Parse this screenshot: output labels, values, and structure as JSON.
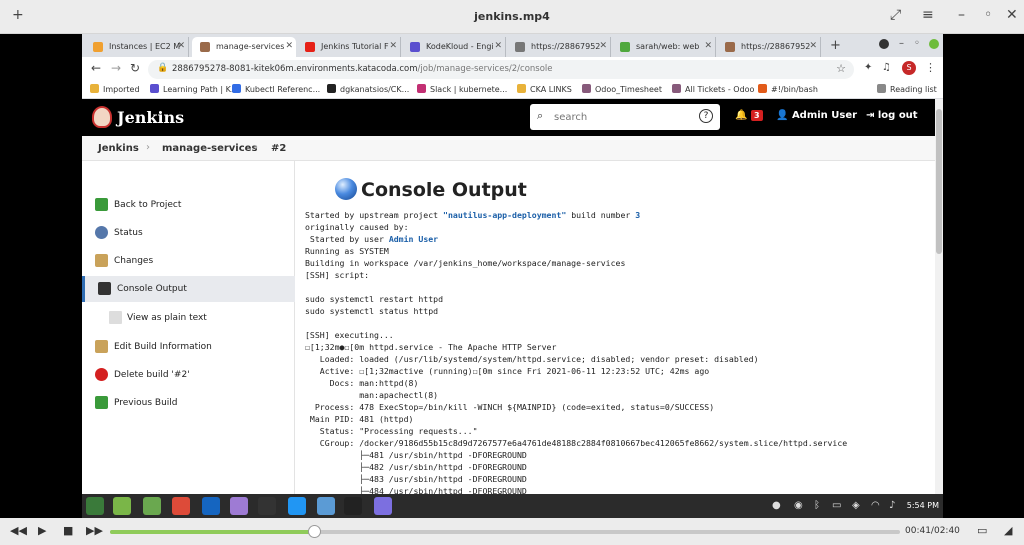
{
  "player": {
    "title": "jenkins.mp4",
    "add_label": "+",
    "timecode": "00:41/02:40",
    "progress": 0.258
  },
  "browser": {
    "tabs": [
      {
        "label": "Instances | EC2 M",
        "color": "#f0a030"
      },
      {
        "label": "manage-services",
        "color": "#9a6a4a",
        "active": true
      },
      {
        "label": "Jenkins Tutorial F",
        "color": "#e62117"
      },
      {
        "label": "KodeKloud - Engi",
        "color": "#5a4fcf"
      },
      {
        "label": "https://28867952",
        "color": "#777777"
      },
      {
        "label": "sarah/web: web",
        "color": "#4fa83d"
      },
      {
        "label": "https://28867952",
        "color": "#9a6a4a"
      }
    ],
    "new_tab": "+",
    "url_host": "2886795278-8081-kitek06m.environments.katacoda.com",
    "url_path": "/job/manage-services/2/console",
    "profile_initial": "S",
    "bookmarks": [
      {
        "label": "Imported",
        "color": "#e8b23a"
      },
      {
        "label": "Learning Path | K...",
        "color": "#5a4fcf"
      },
      {
        "label": "Kubectl Referenc...",
        "color": "#326ce5"
      },
      {
        "label": "dgkanatsios/CK...",
        "color": "#222222"
      },
      {
        "label": "Slack | kubernete...",
        "color": "#c22f73"
      },
      {
        "label": "CKA LINKS",
        "color": "#e8b23a"
      },
      {
        "label": "Odoo_Timesheet",
        "color": "#875a7b"
      },
      {
        "label": "All Tickets - Odoo",
        "color": "#875a7b"
      },
      {
        "label": "#!/bin/bash",
        "color": "#e25b1a"
      }
    ],
    "reading_list": "Reading list"
  },
  "jenkins": {
    "brand": "Jenkins",
    "search_placeholder": "search",
    "notifications": "3",
    "user": "Admin User",
    "logout": "log out",
    "breadcrumbs": [
      "Jenkins",
      "manage-services",
      "#2"
    ],
    "sidebar": [
      {
        "label": "Back to Project"
      },
      {
        "label": "Status"
      },
      {
        "label": "Changes"
      },
      {
        "label": "Console Output",
        "active": true
      },
      {
        "label": "View as plain text",
        "sub": true
      },
      {
        "label": "Edit Build Information"
      },
      {
        "label": "Delete build '#2'"
      },
      {
        "label": "Previous Build"
      }
    ],
    "console_title": "Console Output",
    "console": {
      "l1_pre": "Started by upstream project ",
      "l1_project": "\"nautilus-app-deployment\"",
      "l1_mid": " build number ",
      "l1_build": "3",
      "l2": "originally caused by:",
      "l3_pre": " Started by user ",
      "l3_user": "Admin User",
      "rest": "Running as SYSTEM\nBuilding in workspace /var/jenkins_home/workspace/manage-services\n[SSH] script:\n\nsudo systemctl restart httpd\nsudo systemctl status httpd\n\n[SSH] executing...\n☐[1;32m●☐[0m httpd.service - The Apache HTTP Server\n   Loaded: loaded (/usr/lib/systemd/system/httpd.service; disabled; vendor preset: disabled)\n   Active: ☐[1;32mactive (running)☐[0m since Fri 2021-06-11 12:23:52 UTC; 42ms ago\n     Docs: man:httpd(8)\n           man:apachectl(8)\n  Process: 478 ExecStop=/bin/kill -WINCH ${MAINPID} (code=exited, status=0/SUCCESS)\n Main PID: 481 (httpd)\n   Status: \"Processing requests...\"\n   CGroup: /docker/9186d55b15c8d9d7267577e6a4761de48188c2884f0810667bec412065fe8662/system.slice/httpd.service\n           ├─481 /usr/sbin/httpd -DFOREGROUND\n           ├─482 /usr/sbin/httpd -DFOREGROUND\n           ├─483 /usr/sbin/httpd -DFOREGROUND\n           ├─484 /usr/sbin/httpd -DFOREGROUND"
    }
  },
  "taskbar": {
    "time": "5:54 PM",
    "apps": [
      "#3a7a3a",
      "#7ab648",
      "#6aa84f",
      "#dd4b39",
      "#1565c0",
      "#9e7bd4",
      "#333333",
      "#2196f3",
      "#5b9bd5",
      "#222222",
      "#7c6fe0"
    ]
  }
}
